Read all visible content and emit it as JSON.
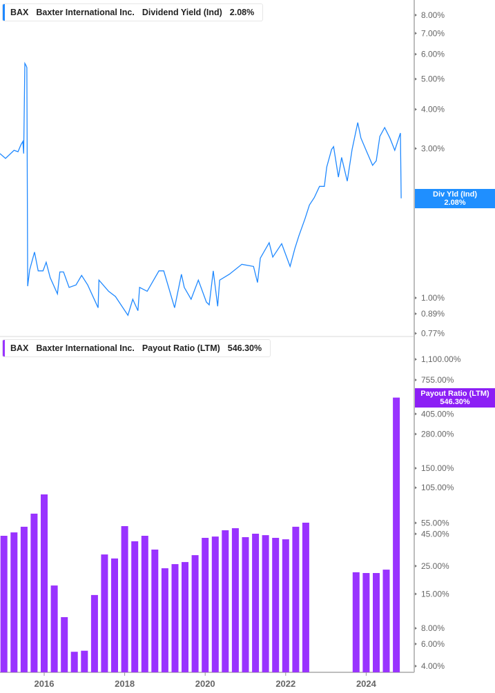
{
  "colors": {
    "yield": "#1e88ff",
    "payout": "#9933ff",
    "axis": "#bdbdbd"
  },
  "top_legend": {
    "ticker": "BAX",
    "company": "Baxter International Inc.",
    "metric": "Dividend Yield (Ind)",
    "value": "2.08%"
  },
  "bottom_legend": {
    "ticker": "BAX",
    "company": "Baxter International Inc.",
    "metric": "Payout Ratio (LTM)",
    "value": "546.30%"
  },
  "top_tag": {
    "label": "Div Yld (Ind)",
    "value": "2.08%"
  },
  "bottom_tag": {
    "label": "Payout Ratio (LTM)",
    "value": "546.30%"
  },
  "chart_data": [
    {
      "type": "line",
      "series_name": "Dividend Yield (Ind)",
      "yscale": "log",
      "ylim": [
        0.76,
        8.9
      ],
      "xlim": [
        2014.9,
        2025.19
      ],
      "y_ticks": [
        {
          "v": 8,
          "label": "8.00%"
        },
        {
          "v": 7,
          "label": "7.00%"
        },
        {
          "v": 6,
          "label": "6.00%"
        },
        {
          "v": 5,
          "label": "5.00%"
        },
        {
          "v": 4,
          "label": "4.00%"
        },
        {
          "v": 3,
          "label": "3.00%"
        },
        {
          "v": 2,
          "label": "2.00%"
        },
        {
          "v": 1,
          "label": "1.00%"
        },
        {
          "v": 0.89,
          "label": "0.89%"
        },
        {
          "v": 0.77,
          "label": "0.77%"
        }
      ],
      "x": [
        2014.9,
        2014.97,
        2015.04,
        2015.14,
        2015.25,
        2015.35,
        2015.42,
        2015.47,
        2015.49,
        2015.52,
        2015.55,
        2015.57,
        2015.59,
        2015.64,
        2015.76,
        2015.85,
        2015.97,
        2016.05,
        2016.15,
        2016.33,
        2016.39,
        2016.48,
        2016.62,
        2016.79,
        2016.93,
        2017.08,
        2017.34,
        2017.36,
        2017.6,
        2017.77,
        2018.08,
        2018.2,
        2018.33,
        2018.37,
        2018.56,
        2018.85,
        2018.97,
        2019.24,
        2019.41,
        2019.48,
        2019.65,
        2019.83,
        2020.03,
        2020.1,
        2020.2,
        2020.31,
        2020.36,
        2020.6,
        2020.91,
        2021.2,
        2021.3,
        2021.37,
        2021.59,
        2021.68,
        2021.9,
        2022.11,
        2022.23,
        2022.33,
        2022.48,
        2022.59,
        2022.71,
        2022.84,
        2022.96,
        2023.02,
        2023.14,
        2023.19,
        2023.31,
        2023.39,
        2023.53,
        2023.65,
        2023.79,
        2023.87,
        2023.99,
        2024.16,
        2024.25,
        2024.34,
        2024.46,
        2024.59,
        2024.71,
        2024.85,
        2024.87
      ],
      "y": [
        2.89,
        2.84,
        2.79,
        2.87,
        2.96,
        2.93,
        3.08,
        3.16,
        2.89,
        5.61,
        5.52,
        5.44,
        1.09,
        1.23,
        1.4,
        1.22,
        1.22,
        1.3,
        1.16,
        1.03,
        1.21,
        1.21,
        1.08,
        1.1,
        1.18,
        1.1,
        0.93,
        1.14,
        1.05,
        1.01,
        0.88,
        0.99,
        0.91,
        1.08,
        1.05,
        1.22,
        1.22,
        0.93,
        1.19,
        1.08,
        0.99,
        1.14,
        0.97,
        0.95,
        1.22,
        0.94,
        1.14,
        1.19,
        1.28,
        1.26,
        1.12,
        1.34,
        1.5,
        1.35,
        1.49,
        1.26,
        1.44,
        1.58,
        1.79,
        1.98,
        2.09,
        2.27,
        2.27,
        2.62,
        2.98,
        3.04,
        2.43,
        2.81,
        2.36,
        2.98,
        3.63,
        3.24,
        2.98,
        2.65,
        2.74,
        3.28,
        3.5,
        3.24,
        2.96,
        3.36,
        2.08
      ]
    },
    {
      "type": "bar",
      "series_name": "Payout Ratio (LTM)",
      "yscale": "log",
      "ylim": [
        3.6,
        1300
      ],
      "xlim": [
        2014.9,
        2025.19
      ],
      "y_ticks": [
        {
          "v": 1100,
          "label": "1,100.00%"
        },
        {
          "v": 755,
          "label": "755.00%"
        },
        {
          "v": 405,
          "label": "405.00%"
        },
        {
          "v": 280,
          "label": "280.00%"
        },
        {
          "v": 150,
          "label": "150.00%"
        },
        {
          "v": 105,
          "label": "105.00%"
        },
        {
          "v": 55,
          "label": "55.00%"
        },
        {
          "v": 45,
          "label": "45.00%"
        },
        {
          "v": 25,
          "label": "25.00%"
        },
        {
          "v": 15,
          "label": "15.00%"
        },
        {
          "v": 8,
          "label": "8.00%"
        },
        {
          "v": 6,
          "label": "6.00%"
        },
        {
          "v": 4,
          "label": "4.00%"
        }
      ],
      "x_ticks": [
        "2016",
        "2018",
        "2020",
        "2022",
        "2024"
      ],
      "categories": [
        "2014-12",
        "2015-03",
        "2015-06",
        "2015-09",
        "2015-12",
        "2016-03",
        "2016-06",
        "2016-09",
        "2016-12",
        "2017-03",
        "2017-06",
        "2017-09",
        "2017-12",
        "2018-03",
        "2018-06",
        "2018-09",
        "2018-12",
        "2019-03",
        "2019-06",
        "2019-09",
        "2019-12",
        "2020-03",
        "2020-06",
        "2020-09",
        "2020-12",
        "2021-03",
        "2021-06",
        "2021-09",
        "2021-12",
        "2022-03",
        "2022-06",
        "2022-09",
        "2022-12",
        "2023-03",
        "2023-06",
        "2023-09",
        "2023-12",
        "2024-03",
        "2024-06",
        "2024-09"
      ],
      "values": [
        43.5,
        46.3,
        51.3,
        65.2,
        92.8,
        17.5,
        9.8,
        5.2,
        5.3,
        14.7,
        30.9,
        28.7,
        51.9,
        39.3,
        43.5,
        33.8,
        24.0,
        25.9,
        26.9,
        30.5,
        41.9,
        42.9,
        48.1,
        50.0,
        42.4,
        45.2,
        44.0,
        41.9,
        40.8,
        51.3,
        55.3,
        null,
        null,
        null,
        null,
        22.3,
        22.0,
        22.0,
        23.4,
        546.3
      ]
    }
  ]
}
